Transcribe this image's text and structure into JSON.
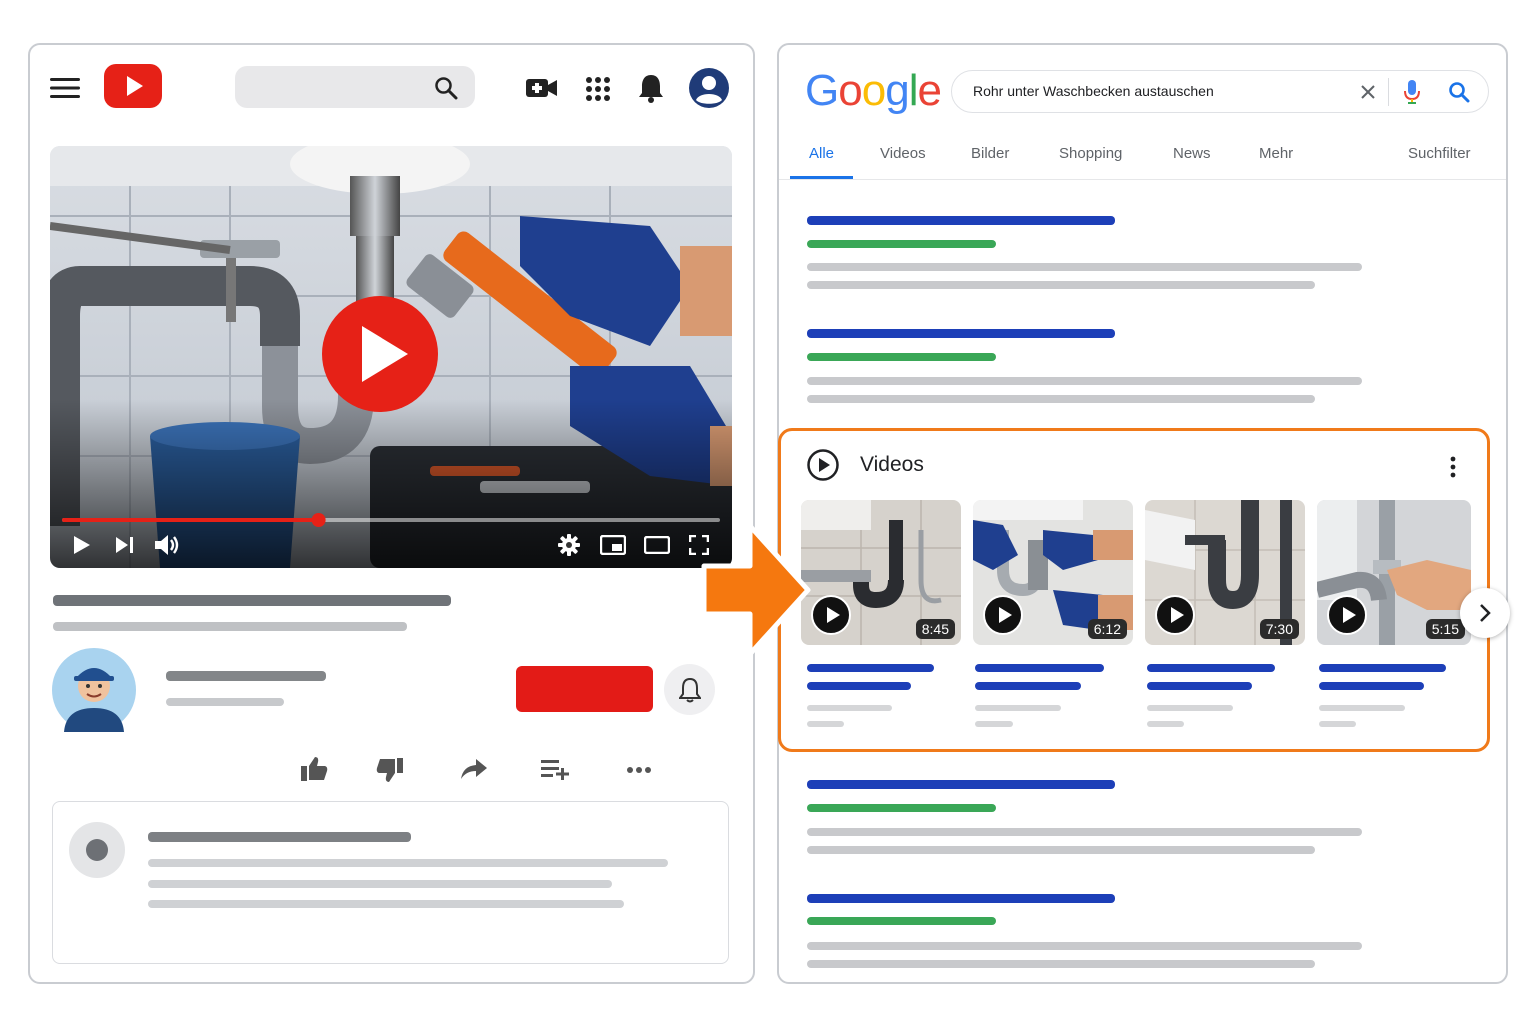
{
  "google": {
    "logo_letters": [
      {
        "ch": "G",
        "color": "#4285F4"
      },
      {
        "ch": "o",
        "color": "#EA4335"
      },
      {
        "ch": "o",
        "color": "#FBBC05"
      },
      {
        "ch": "g",
        "color": "#4285F4"
      },
      {
        "ch": "l",
        "color": "#34A853"
      },
      {
        "ch": "e",
        "color": "#EA4335"
      }
    ],
    "query": "Rohr unter Waschbecken austauschen",
    "tabs": [
      "Alle",
      "Videos",
      "Bilder",
      "Shopping",
      "News",
      "Mehr"
    ],
    "search_tools": "Suchfilter",
    "active_tab_color": "#1a73e8",
    "video_section": {
      "title": "Videos",
      "highlight_color": "#f07a1a",
      "videos": [
        {
          "duration": "8:45"
        },
        {
          "duration": "6:12"
        },
        {
          "duration": "7:30"
        },
        {
          "duration": "5:15"
        }
      ]
    }
  },
  "youtube": {
    "brand_red": "#e62117",
    "progress_fraction": 0.39,
    "icons": [
      "menu-icon",
      "youtube-logo",
      "search-icon",
      "create-video-icon",
      "apps-grid-icon",
      "bell-icon",
      "account-icon",
      "play-icon",
      "next-icon",
      "volume-icon",
      "settings-icon",
      "miniplayer-icon",
      "theater-icon",
      "fullscreen-icon",
      "like-icon",
      "dislike-icon",
      "share-icon",
      "add-to-playlist-icon",
      "more-icon"
    ]
  },
  "colors": {
    "link_blue": "#1d3fb8",
    "url_green": "#3aa757",
    "text_gray": "#c8c9cc",
    "arrow_orange": "#f5780f"
  }
}
